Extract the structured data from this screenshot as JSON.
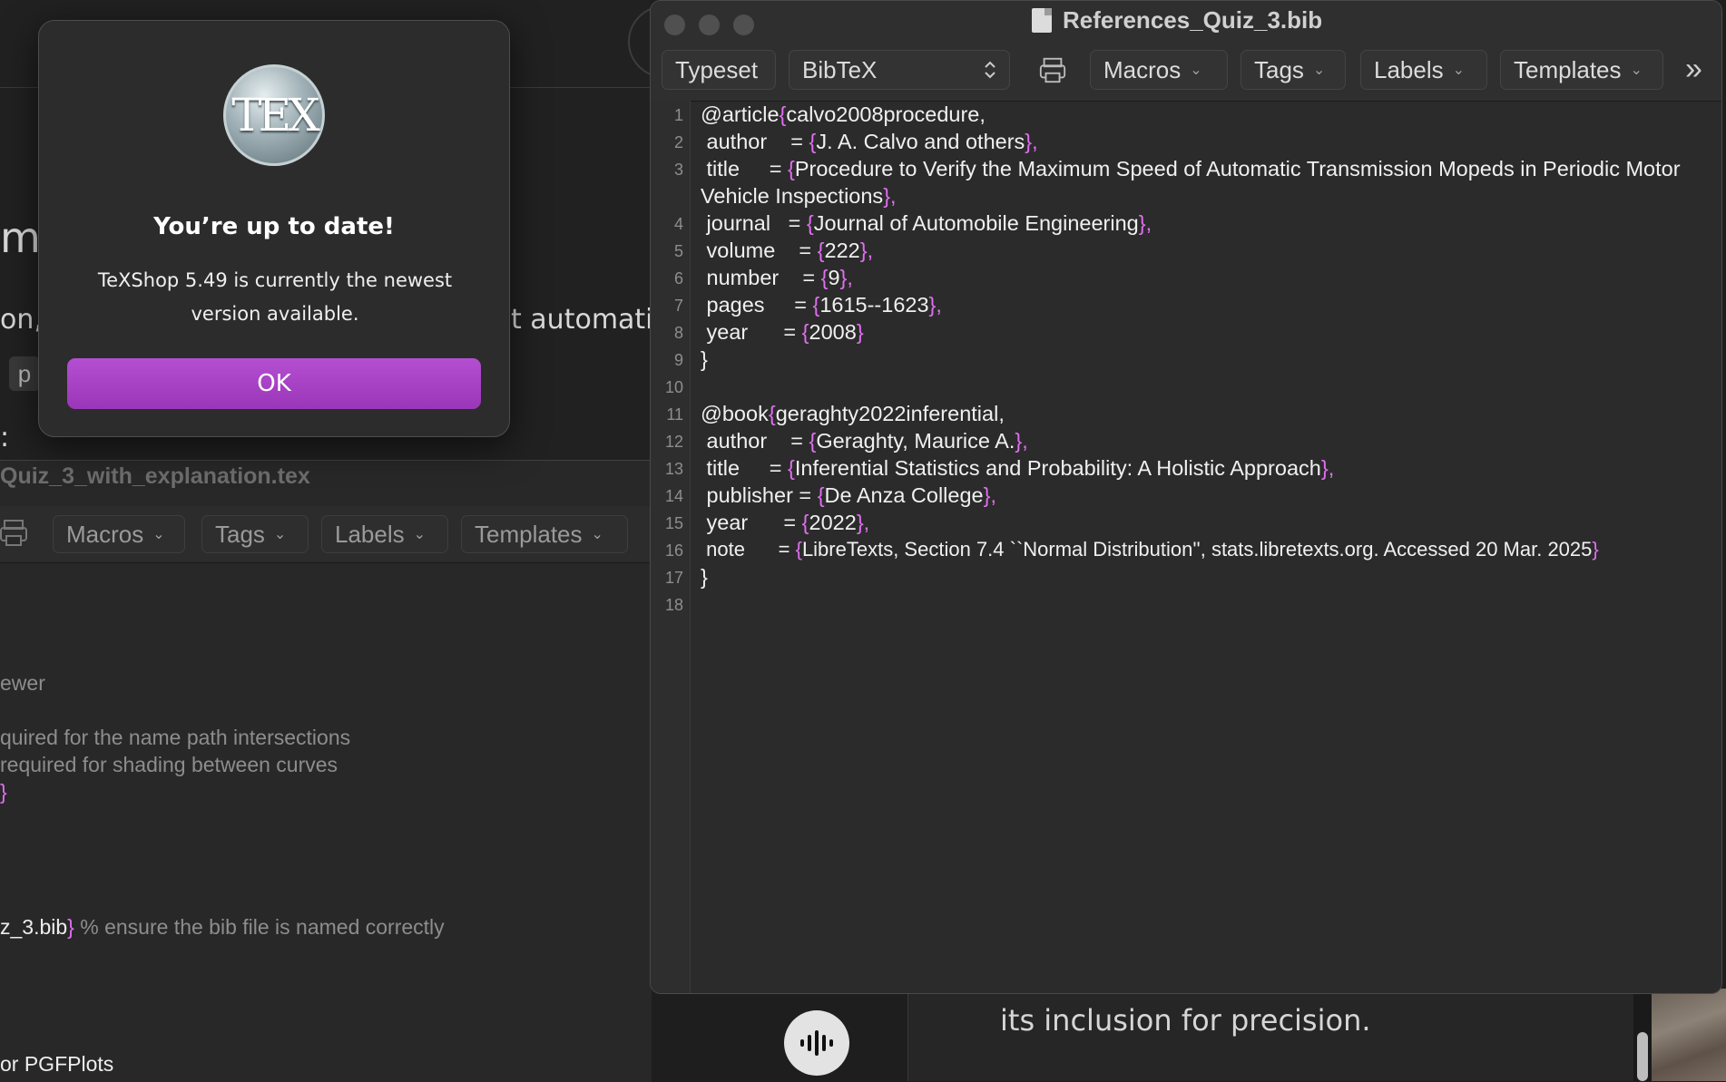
{
  "background_chat": {
    "fragments": [
      "m",
      "on,",
      "t automatic",
      "p",
      ":"
    ],
    "bottom_text": "its inclusion for precision."
  },
  "back_editor": {
    "title": "Quiz_3_with_explanation.tex",
    "toolbar": {
      "macros": "Macros",
      "tags": "Tags",
      "labels": "Labels",
      "templates": "Templates"
    },
    "lines": {
      "l1": "ewer",
      "l2": "quired for the name path intersections",
      "l3": "required for shading between curves",
      "l4_brace": "}",
      "l5_text": "z_3.bib",
      "l5_brace": "}",
      "l5_comment": " % ensure the bib file is named correctly",
      "l6": "or PGFPlots"
    }
  },
  "main_window": {
    "title": "References_Quiz_3.bib",
    "toolbar": {
      "typeset": "Typeset",
      "engine": "BibTeX",
      "macros": "Macros",
      "tags": "Tags",
      "labels": "Labels",
      "templates": "Templates",
      "overflow": "»"
    },
    "line_numbers": [
      "1",
      "2",
      "3",
      "4",
      "5",
      "6",
      "7",
      "8",
      "9",
      "10",
      "11",
      "12",
      "13",
      "14",
      "15",
      "16",
      "17",
      "18"
    ],
    "code": {
      "c1a": "@article",
      "c1b": "{",
      "c1c": "calvo2008procedure,",
      "c2a": " author    = ",
      "c2b": "{",
      "c2c": "J. A. Calvo and others",
      "c2d": "},",
      "c3a": " title     = ",
      "c3b": "{",
      "c3c": "Procedure to Verify the Maximum Speed of Automatic Transmission Mopeds in Periodic Motor",
      "c3w": "Vehicle Inspections",
      "c3d": "},",
      "c4a": " journal   = ",
      "c4b": "{",
      "c4c": "Journal of Automobile Engineering",
      "c4d": "},",
      "c5a": " volume    = ",
      "c5b": "{",
      "c5c": "222",
      "c5d": "},",
      "c6a": " number    = ",
      "c6b": "{",
      "c6c": "9",
      "c6d": "},",
      "c7a": " pages     = ",
      "c7b": "{",
      "c7c": "1615--1623",
      "c7d": "},",
      "c8a": " year      = ",
      "c8b": "{",
      "c8c": "2008",
      "c8d": "}",
      "c9": "}",
      "c11a": "@book",
      "c11b": "{",
      "c11c": "geraghty2022inferential,",
      "c12a": " author    = ",
      "c12b": "{",
      "c12c": "Geraghty, Maurice A.",
      "c12d": "},",
      "c13a": " title     = ",
      "c13b": "{",
      "c13c": "Inferential Statistics and Probability: A Holistic Approach",
      "c13d": "},",
      "c14a": " publisher = ",
      "c14b": "{",
      "c14c": "De Anza College",
      "c14d": "},",
      "c15a": " year      = ",
      "c15b": "{",
      "c15c": "2022",
      "c15d": "},",
      "c16a": " note      = ",
      "c16b": "{",
      "c16c": "LibreTexts, Section 7.4 ``Normal Distribution'', stats.libretexts.org. Accessed 20 Mar. 2025",
      "c16d": "}",
      "c17": "}"
    }
  },
  "dialog": {
    "logo_text": "TEX",
    "heading": "You’re up to date!",
    "body": "TeXShop 5.49 is currently the newest version available.",
    "ok": "OK"
  },
  "colors": {
    "brace": "#e06ef0",
    "ok_button": "#a940c6",
    "window_bg": "#2b2b2b"
  },
  "icons": [
    "tex-logo",
    "document-icon",
    "printer-icon",
    "chevron-down-icon",
    "updown-chevron-icon",
    "microphone-waveform-icon"
  ]
}
